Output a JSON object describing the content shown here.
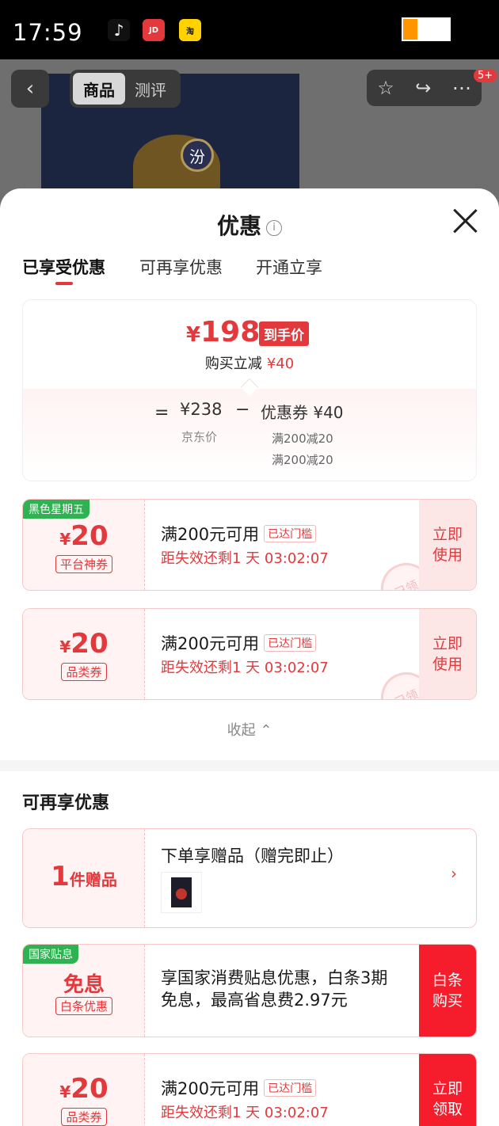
{
  "status_bar": {
    "time": "17:59",
    "apps": [
      "TikTok",
      "京东",
      "淘宝"
    ]
  },
  "header": {
    "tabs": [
      "商品",
      "测评"
    ],
    "badge": "5+",
    "product_mark": "汾"
  },
  "sheet": {
    "title": "优惠",
    "tabs": [
      "已享受优惠",
      "可再享优惠",
      "开通立享"
    ],
    "price_card": {
      "currency": "¥",
      "final_price": "198",
      "final_tag": "到手价",
      "reduce_label": "购买立减",
      "reduce_amount": "¥40",
      "equals": "=",
      "jd_price": "¥238",
      "jd_label": "京东价",
      "minus": "−",
      "coupon_label": "优惠券 ¥40",
      "rules": [
        "满200减20",
        "满200减20"
      ]
    },
    "coupons": [
      {
        "ribbon": "黑色星期五",
        "currency": "¥",
        "amount": "20",
        "type": "平台神券",
        "desc": "满200元可用",
        "tag": "已达门槛",
        "countdown": "距失效还剩1 天 03:02:07",
        "btn": "立即\n使用",
        "stamp": "已领"
      },
      {
        "ribbon": "",
        "currency": "¥",
        "amount": "20",
        "type": "品类券",
        "desc": "满200元可用",
        "tag": "已达门槛",
        "countdown": "距失效还剩1 天 03:02:07",
        "btn": "立即\n使用",
        "stamp": "已领"
      }
    ],
    "collapse": "收起 ⌃",
    "section_title": "可再享优惠",
    "gift": {
      "num": "1",
      "unit": "件赠品",
      "title": "下单享赠品（赠完即止）"
    },
    "subsidy": {
      "ribbon": "国家贴息",
      "big": "免息",
      "type": "白条优惠",
      "desc": "享国家消费贴息优惠，白条3期免息，最高省息费2.97元",
      "btn": "白条\n购买"
    },
    "coupon3": {
      "currency": "¥",
      "amount": "20",
      "type": "品类券",
      "desc": "满200元可用",
      "tag": "已达门槛",
      "countdown": "距失效还剩1 天 03:02:07",
      "btn": "立即\n领取"
    }
  }
}
